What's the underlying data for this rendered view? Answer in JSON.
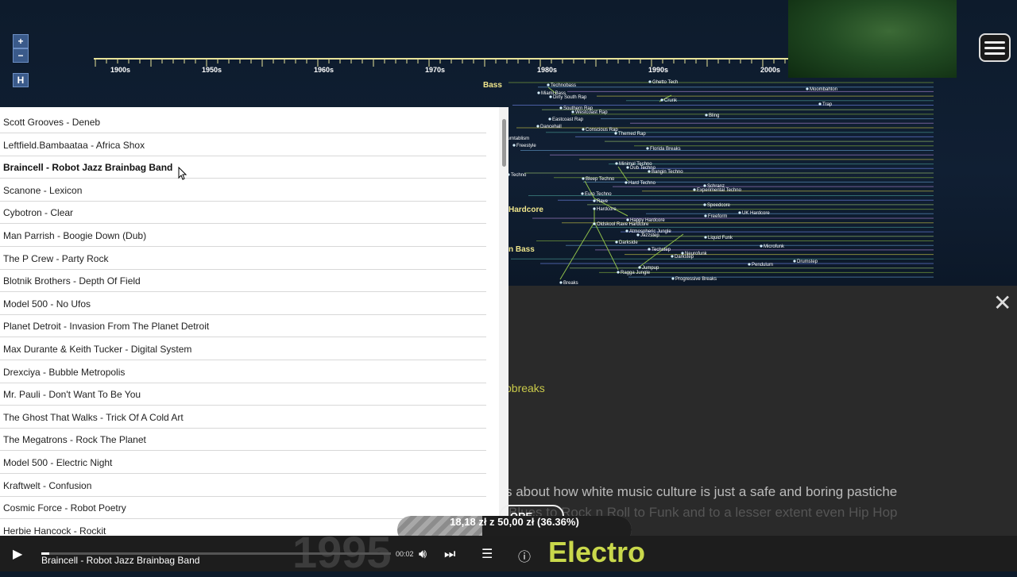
{
  "timeline": {
    "decades": [
      "1900s",
      "1950s",
      "1960s",
      "1970s",
      "1980s",
      "1990s",
      "2000s"
    ]
  },
  "map": {
    "major_genres": [
      "Bass",
      "Hardcore",
      "n Bass"
    ],
    "nodes": [
      "Technobass",
      "Ghetto Tech",
      "Miami Bass",
      "Dirty South Rap",
      "Moombahton",
      "Crunk",
      "Southern Rap",
      "Westcoast Rap",
      "Trap",
      "Bling",
      "Eastcoast Rap",
      "Dancehall",
      "Conscious Rap",
      "Themed Rap",
      "Turntablism",
      "Freestyle",
      "Florida Breaks",
      "Minimal Techno",
      "Dub Techno",
      "Bangin Techno",
      "Techno",
      "Bleep Techno",
      "Hard Techno",
      "Schranz",
      "Experimental Techno",
      "Euro Techno",
      "Rave",
      "Hardcore",
      "Speedcore",
      "Freeform",
      "UK Hardcore",
      "Happy Hardcore",
      "Oldskool Rave Hardcore",
      "Atmospheric Jungle",
      "Jazzstep",
      "Liquid Funk",
      "Darkside",
      "Microfunk",
      "Techstep",
      "Neurofunk",
      "Darkstep",
      "Drumstep",
      "Pendulum",
      "Jumpup",
      "Ragga Jungle",
      "Progressive Breaks",
      "Breaks"
    ]
  },
  "controls": {
    "zoom_in": "+",
    "zoom_out": "−",
    "home": "H"
  },
  "playlist": {
    "tracks": [
      "Scott Grooves - Deneb",
      "Leftfield.Bambaataa - Africa Shox",
      "Braincell - Robot Jazz Brainbag Band",
      "Scanone - Lexicon",
      "Cybotron - Clear",
      "Man Parrish - Boogie Down (Dub)",
      "The P Crew - Party Rock",
      "Blotnik Brothers - Depth Of Field",
      "Model 500 - No Ufos",
      "Planet Detroit - Invasion From The Planet Detroit",
      "Max Durante & Keith Tucker - Digital System",
      "Drexciya - Bubble Metropolis",
      "Mr. Pauli - Don't Want To Be You",
      "The Ghost That Walks - Trick Of A Cold Art",
      "The Megatrons - Rock The Planet",
      "Model 500 - Electric Night",
      "Kraftwelt - Confusion",
      "Cosmic Force - Robot Poetry",
      "Herbie Hancock - Rockit"
    ],
    "active_index": 2
  },
  "info": {
    "breaks_label": "obreaks",
    "description_line1": "s about how white music culture is just a safe and boring pastiche",
    "description_line2": "Blues to Rock n Roll to Funk and to a lesser extent even Hip Hop",
    "more_label": "ORE"
  },
  "donation": {
    "text": "18,18 zł  z  50,00 zł  (36.36%)",
    "fraction": 0.3636
  },
  "player": {
    "now_playing": "Braincell - Robot Jazz Brainbag Band",
    "time": "00:02",
    "year": "1995",
    "genre": "Electro"
  },
  "colors": {
    "genre_text": "#c9d84b",
    "map_bg": "#0d1a2a"
  }
}
